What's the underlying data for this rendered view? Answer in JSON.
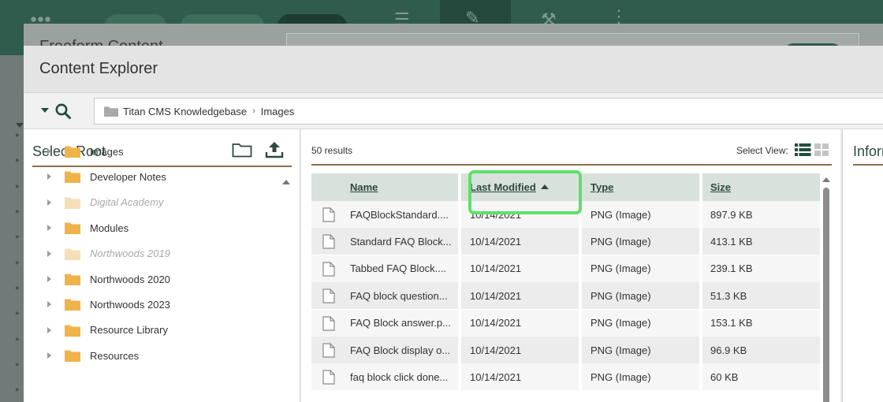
{
  "background": {
    "dialog_title": "Freeform Content"
  },
  "modal": {
    "title": "Content Explorer"
  },
  "breadcrumb": {
    "root": "Titan CMS Knowledgebase",
    "current": "Images"
  },
  "tree": {
    "title": "Select Root",
    "items": [
      {
        "label": "Images",
        "dim": false
      },
      {
        "label": "Developer Notes",
        "dim": false
      },
      {
        "label": "Digital Academy",
        "dim": true
      },
      {
        "label": "Modules",
        "dim": false
      },
      {
        "label": "Northwoods 2019",
        "dim": true
      },
      {
        "label": "Northwoods 2020",
        "dim": false
      },
      {
        "label": "Northwoods 2023",
        "dim": false
      },
      {
        "label": "Resource Library",
        "dim": false
      },
      {
        "label": "Resources",
        "dim": false
      }
    ]
  },
  "results": {
    "count_label": "50 results",
    "select_view_label": "Select View:",
    "columns": {
      "name": "Name",
      "last_modified": "Last Modified",
      "type": "Type",
      "size": "Size"
    },
    "rows": [
      {
        "name": "FAQBlockStandard....",
        "modified": "10/14/2021",
        "type": "PNG (Image)",
        "size": "897.9 KB"
      },
      {
        "name": "Standard FAQ Block...",
        "modified": "10/14/2021",
        "type": "PNG (Image)",
        "size": "413.1 KB"
      },
      {
        "name": "Tabbed FAQ Block....",
        "modified": "10/14/2021",
        "type": "PNG (Image)",
        "size": "239.1 KB"
      },
      {
        "name": "FAQ block question...",
        "modified": "10/14/2021",
        "type": "PNG (Image)",
        "size": "51.3 KB"
      },
      {
        "name": "FAQ Block answer.p...",
        "modified": "10/14/2021",
        "type": "PNG (Image)",
        "size": "153.1 KB"
      },
      {
        "name": "FAQ Block display o...",
        "modified": "10/14/2021",
        "type": "PNG (Image)",
        "size": "96.9 KB"
      },
      {
        "name": "faq block click done...",
        "modified": "10/14/2021",
        "type": "PNG (Image)",
        "size": "60 KB"
      }
    ]
  },
  "info": {
    "title": "Information"
  },
  "colors": {
    "brand_dark": "#2f5c4c",
    "accent_rule": "#8a6f4a",
    "highlight": "#5fe06a",
    "folder": "#f0b34a",
    "folder_dim": "#f6dfb8"
  }
}
